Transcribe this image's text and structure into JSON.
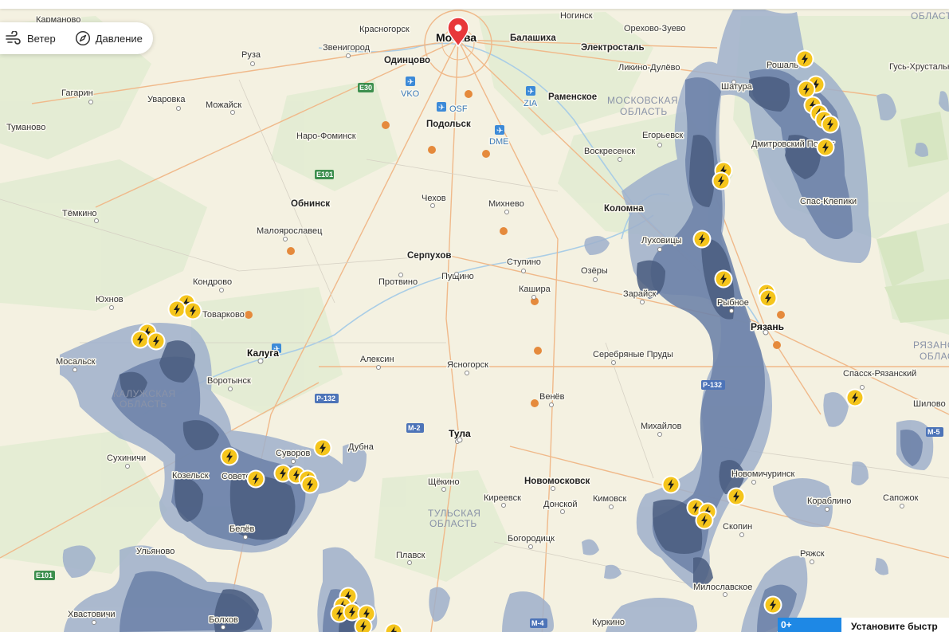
{
  "toolbar": {
    "wind_label": "Ветер",
    "wind_icon": "wind-icon",
    "pressure_label": "Давление",
    "pressure_icon": "compass-icon"
  },
  "map": {
    "marker_icon": "location-pin-icon",
    "lightning_icon": "lightning-bolt-icon",
    "cities": [
      {
        "name": "Карманово"
      },
      {
        "name": "Красногорск"
      },
      {
        "name": "Москва"
      },
      {
        "name": "Ногинск"
      },
      {
        "name": "Орехово-Зуево"
      },
      {
        "name": "Руза"
      },
      {
        "name": "Звенигород"
      },
      {
        "name": "Одинцово"
      },
      {
        "name": "Балашиха"
      },
      {
        "name": "Электросталь"
      },
      {
        "name": "Ликино-Дулёво"
      },
      {
        "name": "Рошаль"
      },
      {
        "name": "Гусь-Хрустальный"
      },
      {
        "name": "Гагарин"
      },
      {
        "name": "Уваровка"
      },
      {
        "name": "Можайск"
      },
      {
        "name": "Раменское"
      },
      {
        "name": "Шатура"
      },
      {
        "name": "Тумановo"
      },
      {
        "name": "Подольск"
      },
      {
        "name": "Наро-Фоминск"
      },
      {
        "name": "Воскресенск"
      },
      {
        "name": "Егорьевск"
      },
      {
        "name": "Дмитровский Погост"
      },
      {
        "name": "Обнинск"
      },
      {
        "name": "Чехов"
      },
      {
        "name": "Михнево"
      },
      {
        "name": "Тёмкино"
      },
      {
        "name": "Коломна"
      },
      {
        "name": "Спас-Клепики"
      },
      {
        "name": "Малоярославец"
      },
      {
        "name": "Луховицы"
      },
      {
        "name": "Серпухов"
      },
      {
        "name": "Ступино"
      },
      {
        "name": "Кондрово"
      },
      {
        "name": "Протвино"
      },
      {
        "name": "Пущино"
      },
      {
        "name": "Озёры"
      },
      {
        "name": "Юхнов"
      },
      {
        "name": "Кашира"
      },
      {
        "name": "Зарайск"
      },
      {
        "name": "Рыбное"
      },
      {
        "name": "Товарково"
      },
      {
        "name": "Рязань"
      },
      {
        "name": "Калуга"
      },
      {
        "name": "Мосальск"
      },
      {
        "name": "Алексин"
      },
      {
        "name": "Ясногорск"
      },
      {
        "name": "Серебряные Пруды"
      },
      {
        "name": "Воротынск"
      },
      {
        "name": "Спасск-Рязанский"
      },
      {
        "name": "Венёв"
      },
      {
        "name": "Шилово"
      },
      {
        "name": "Михайлов"
      },
      {
        "name": "Тула"
      },
      {
        "name": "Суворов"
      },
      {
        "name": "Дубна"
      },
      {
        "name": "Сухиничи"
      },
      {
        "name": "Козельск"
      },
      {
        "name": "Советск"
      },
      {
        "name": "Щёкино"
      },
      {
        "name": "Новомосковск"
      },
      {
        "name": "Новомичуринск"
      },
      {
        "name": "Киреевск"
      },
      {
        "name": "Кимовск"
      },
      {
        "name": "Донской"
      },
      {
        "name": "Кораблино"
      },
      {
        "name": "Сапожок"
      },
      {
        "name": "Белёв"
      },
      {
        "name": "Скопин"
      },
      {
        "name": "Богородицк"
      },
      {
        "name": "Ульяново"
      },
      {
        "name": "Плавск"
      },
      {
        "name": "Ряжск"
      },
      {
        "name": "Милославское"
      },
      {
        "name": "Хвастовичи"
      },
      {
        "name": "Болхов"
      },
      {
        "name": "Куркино"
      }
    ],
    "regions": [
      {
        "name1": "МОСКОВСКАЯ",
        "name2": "ОБЛАСТЬ"
      },
      {
        "name1": "КАЛУЖСКАЯ",
        "name2": "ОБЛАСТЬ"
      },
      {
        "name1": "ТУЛЬСКАЯ",
        "name2": "ОБЛАСТЬ"
      },
      {
        "name1": "РЯЗАНС",
        "name2": "ОБЛАСТ"
      },
      {
        "name1": "ОБЛАСТ",
        "name2": ""
      }
    ],
    "airports": [
      {
        "code": "VKO"
      },
      {
        "code": "OSF"
      },
      {
        "code": "ZIA"
      },
      {
        "code": "DME"
      }
    ],
    "roads": [
      {
        "code": "E30"
      },
      {
        "code": "E101"
      },
      {
        "code": "P-132"
      },
      {
        "code": "M-2"
      },
      {
        "code": "P-132"
      },
      {
        "code": "E101"
      },
      {
        "code": "M-5"
      },
      {
        "code": "M-4"
      }
    ]
  },
  "footer": {
    "age_badge": "0+",
    "promo_text": "Установите быстр"
  }
}
